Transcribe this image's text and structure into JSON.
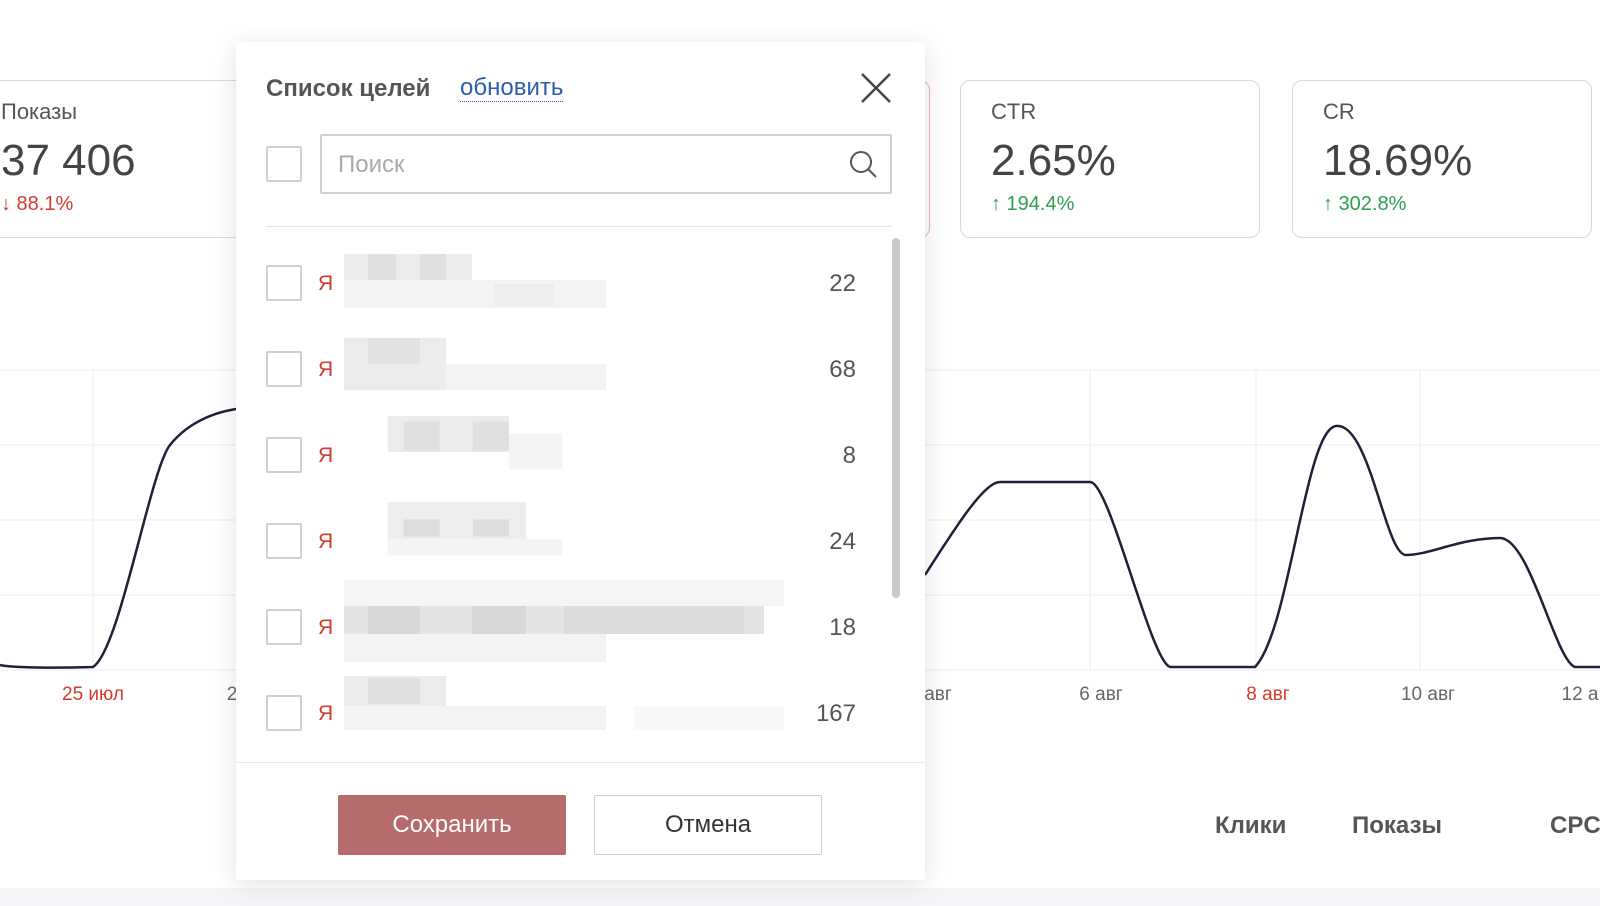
{
  "cards": [
    {
      "label": "Показы",
      "value": "37 406",
      "delta": "↓ 88.1%",
      "direction": "down"
    },
    {
      "label": "CTR",
      "value": "2.65%",
      "delta": "↑ 194.4%",
      "direction": "up"
    },
    {
      "label": "CR",
      "value": "18.69%",
      "delta": "↑ 302.8%",
      "direction": "up"
    }
  ],
  "chart": {
    "x_labels": [
      "25 июл",
      "2",
      "авг",
      "6 авг",
      "8 авг",
      "10 авг",
      "12 а"
    ],
    "highlight_color": "#d23b2e",
    "line_color": "#1c2238"
  },
  "table_headers": [
    "Клики",
    "Показы",
    "CPC"
  ],
  "modal": {
    "title": "Список целей",
    "refresh_label": "обновить",
    "search_placeholder": "Поиск",
    "goals": [
      {
        "icon": "Я",
        "count": "22"
      },
      {
        "icon": "Я",
        "count": "68"
      },
      {
        "icon": "Я",
        "count": "8"
      },
      {
        "icon": "Я",
        "count": "24"
      },
      {
        "icon": "Я",
        "count": "18"
      },
      {
        "icon": "Я",
        "count": "167"
      }
    ],
    "save_label": "Сохранить",
    "cancel_label": "Отмена"
  },
  "colors": {
    "accent": "#b66c6c",
    "link": "#2d5ea8",
    "positive": "#2e9e4f",
    "negative": "#d23b2e"
  }
}
